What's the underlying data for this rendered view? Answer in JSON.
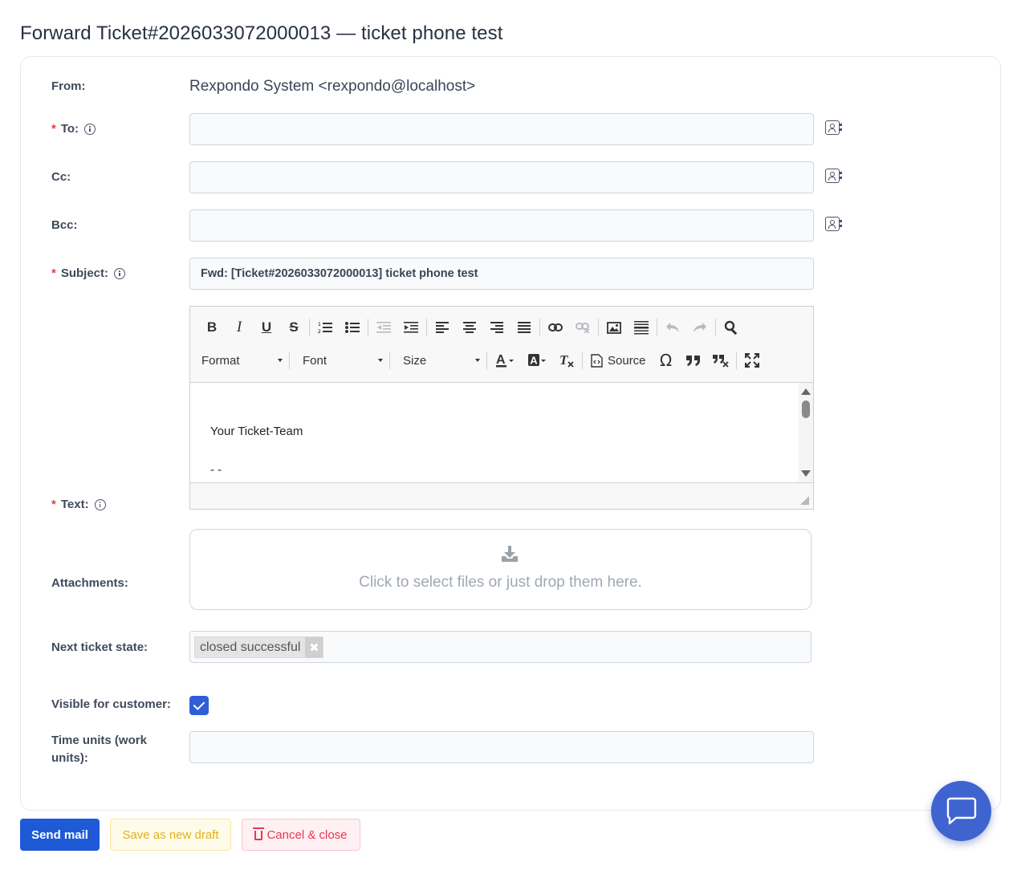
{
  "page": {
    "title": "Forward Ticket#2026033072000013 — ticket phone test"
  },
  "form": {
    "from": {
      "label": "From:",
      "value": "Rexpondo System <rexpondo@localhost>"
    },
    "to": {
      "label": "To:",
      "value": "",
      "placeholder": ""
    },
    "cc": {
      "label": "Cc:",
      "value": "",
      "placeholder": ""
    },
    "bcc": {
      "label": "Bcc:",
      "value": "",
      "placeholder": ""
    },
    "subject": {
      "label": "Subject:",
      "value": "Fwd: [Ticket#2026033072000013] ticket phone test"
    },
    "text": {
      "label": "Text:",
      "toolbar": {
        "format_label": "Format",
        "font_label": "Font",
        "size_label": "Size",
        "source_label": "Source"
      },
      "body_lines": [
        "Your Ticket-Team",
        "- -"
      ]
    },
    "attachments": {
      "label": "Attachments:",
      "dropzone_text": "Click to select files or just drop them here."
    },
    "next_state": {
      "label": "Next ticket state:",
      "selected": "closed successful",
      "remove_glyph": "✖"
    },
    "visible_for_customer": {
      "label": "Visible for customer:",
      "checked": true
    },
    "time_units": {
      "label_line1": "Time units (work",
      "label_line2": "units):",
      "value": ""
    }
  },
  "actions": {
    "send_label": "Send mail",
    "draft_label": "Save as new draft",
    "cancel_label": "Cancel & close"
  },
  "required_marker": "*",
  "colors": {
    "primary": "#1f5ad6",
    "warning": "#e3b116",
    "danger": "#e53855",
    "chat": "#3f64d0"
  }
}
